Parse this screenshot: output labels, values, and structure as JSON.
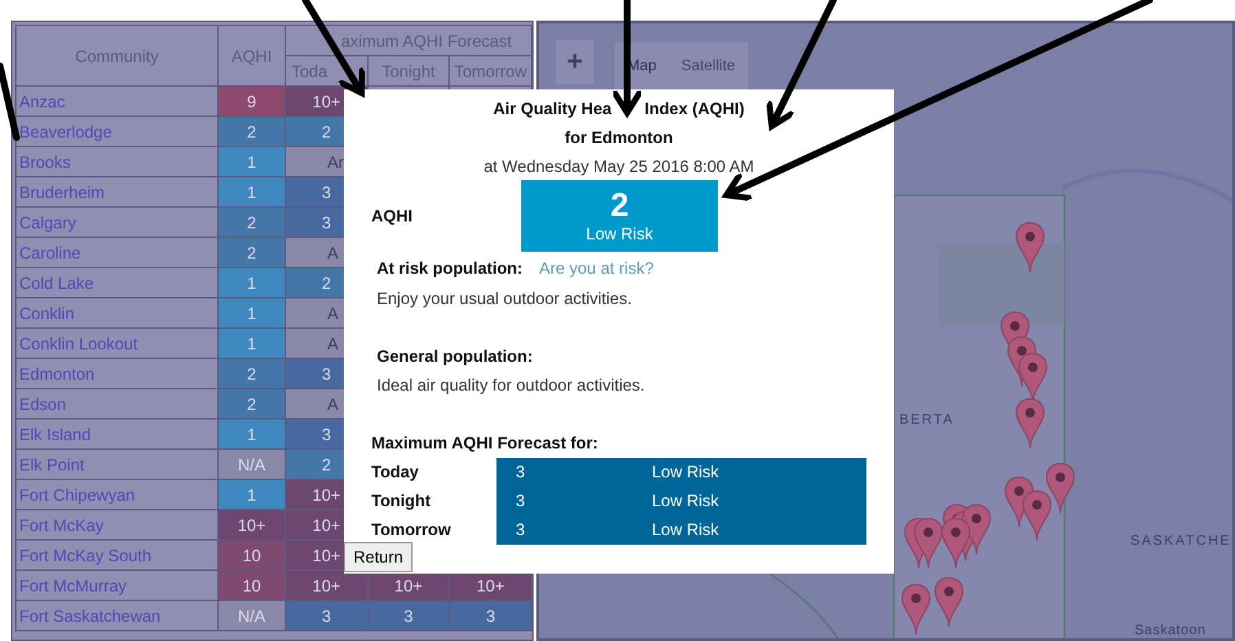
{
  "table": {
    "columns": {
      "community": "Community",
      "aqhi": "AQHI",
      "forecast": "aximum AQHI Forecast",
      "periods": [
        "Toda",
        "Tonight",
        "Tomorrow"
      ]
    },
    "rows": [
      {
        "community": "Anzac",
        "aqhi": {
          "text": "9",
          "color": "#8e4a6e"
        },
        "forecast": [
          {
            "text": "10+",
            "color": "#6e4770"
          }
        ]
      },
      {
        "community": "Beaverlodge",
        "aqhi": {
          "text": "2",
          "color": "#4477a8"
        },
        "forecast": [
          {
            "text": "2",
            "color": "#4477a8"
          }
        ]
      },
      {
        "community": "Brooks",
        "aqhi": {
          "text": "1",
          "color": "#3f88c0"
        },
        "forecast": [
          {
            "text": "Ar",
            "color": "#8a88a8",
            "kind": "unavailable"
          }
        ]
      },
      {
        "community": "Bruderheim",
        "aqhi": {
          "text": "1",
          "color": "#3f88c0"
        },
        "forecast": [
          {
            "text": "3",
            "color": "#4868a0"
          }
        ]
      },
      {
        "community": "Calgary",
        "aqhi": {
          "text": "2",
          "color": "#4477a8"
        },
        "forecast": [
          {
            "text": "3",
            "color": "#4868a0"
          }
        ]
      },
      {
        "community": "Caroline",
        "aqhi": {
          "text": "2",
          "color": "#4477a8"
        },
        "forecast": [
          {
            "text": "A",
            "color": "#8a88a8",
            "kind": "unavailable"
          }
        ]
      },
      {
        "community": "Cold Lake",
        "aqhi": {
          "text": "1",
          "color": "#3f88c0"
        },
        "forecast": [
          {
            "text": "2",
            "color": "#4477a8"
          }
        ]
      },
      {
        "community": "Conklin",
        "aqhi": {
          "text": "1",
          "color": "#3f88c0"
        },
        "forecast": [
          {
            "text": "A",
            "color": "#8a88a8",
            "kind": "unavailable"
          }
        ]
      },
      {
        "community": "Conklin Lookout",
        "aqhi": {
          "text": "1",
          "color": "#3f88c0"
        },
        "forecast": [
          {
            "text": "A",
            "color": "#8a88a8",
            "kind": "unavailable"
          }
        ]
      },
      {
        "community": "Edmonton",
        "aqhi": {
          "text": "2",
          "color": "#4477a8"
        },
        "forecast": [
          {
            "text": "3",
            "color": "#4868a0"
          }
        ]
      },
      {
        "community": "Edson",
        "aqhi": {
          "text": "2",
          "color": "#4477a8"
        },
        "forecast": [
          {
            "text": "A",
            "color": "#8a88a8",
            "kind": "unavailable"
          }
        ]
      },
      {
        "community": "Elk Island",
        "aqhi": {
          "text": "1",
          "color": "#3f88c0"
        },
        "forecast": [
          {
            "text": "3",
            "color": "#4868a0"
          }
        ]
      },
      {
        "community": "Elk Point",
        "aqhi": {
          "text": "N/A",
          "color": "#8a88a8"
        },
        "forecast": [
          {
            "text": "2",
            "color": "#4477a8"
          }
        ]
      },
      {
        "community": "Fort Chipewyan",
        "aqhi": {
          "text": "1",
          "color": "#3f88c0"
        },
        "forecast": [
          {
            "text": "10+",
            "color": "#6e4770"
          }
        ]
      },
      {
        "community": "Fort McKay",
        "aqhi": {
          "text": "10+",
          "color": "#6e4770"
        },
        "forecast": [
          {
            "text": "10+",
            "color": "#6e4770"
          }
        ]
      },
      {
        "community": "Fort McKay South",
        "aqhi": {
          "text": "10",
          "color": "#7e4a70"
        },
        "forecast": [
          {
            "text": "10+",
            "color": "#6e4770"
          }
        ]
      },
      {
        "community": "Fort McMurray",
        "aqhi": {
          "text": "10",
          "color": "#7e4a70"
        },
        "forecast": [
          {
            "text": "10+",
            "color": "#6e4770"
          },
          {
            "text": "10+",
            "color": "#6e4770"
          },
          {
            "text": "10+",
            "color": "#6e4770"
          }
        ]
      },
      {
        "community": "Fort Saskatchewan",
        "aqhi": {
          "text": "N/A",
          "color": "#8a88a8"
        },
        "forecast": [
          {
            "text": "3",
            "color": "#4868a0"
          },
          {
            "text": "3",
            "color": "#4868a0"
          },
          {
            "text": "3",
            "color": "#4868a0"
          }
        ]
      }
    ]
  },
  "map": {
    "zoom_in": "+",
    "map_types": [
      {
        "label": "Map",
        "selected": true
      },
      {
        "label": "Satellite",
        "selected": false
      }
    ],
    "labels": [
      "BERTA",
      "SASKATCHE",
      "Saskatoon"
    ]
  },
  "popup": {
    "title": [
      "Air Quality Hea",
      "Index (AQHI)"
    ],
    "location": "for Edmonton",
    "timestamp": "at Wednesday May 25 2016 8:00 AM",
    "aqhi_label": "AQHI",
    "aqhi_value": "2",
    "aqhi_risk": "Low Risk",
    "at_risk_label": "At risk population:",
    "at_risk_link": "Are you at risk?",
    "at_risk_advice": "Enjoy your usual outdoor activities.",
    "general_label": "General population:",
    "general_advice": "Ideal air quality for outdoor activities.",
    "forecast_heading": "Maximum AQHI Forecast for:",
    "forecast": [
      {
        "period": "Today",
        "value": "3",
        "risk": "Low Risk"
      },
      {
        "period": "Tonight",
        "value": "3",
        "risk": "Low Risk"
      },
      {
        "period": "Tomorrow",
        "value": "3",
        "risk": "Low Risk"
      }
    ],
    "return_button": "Return"
  }
}
